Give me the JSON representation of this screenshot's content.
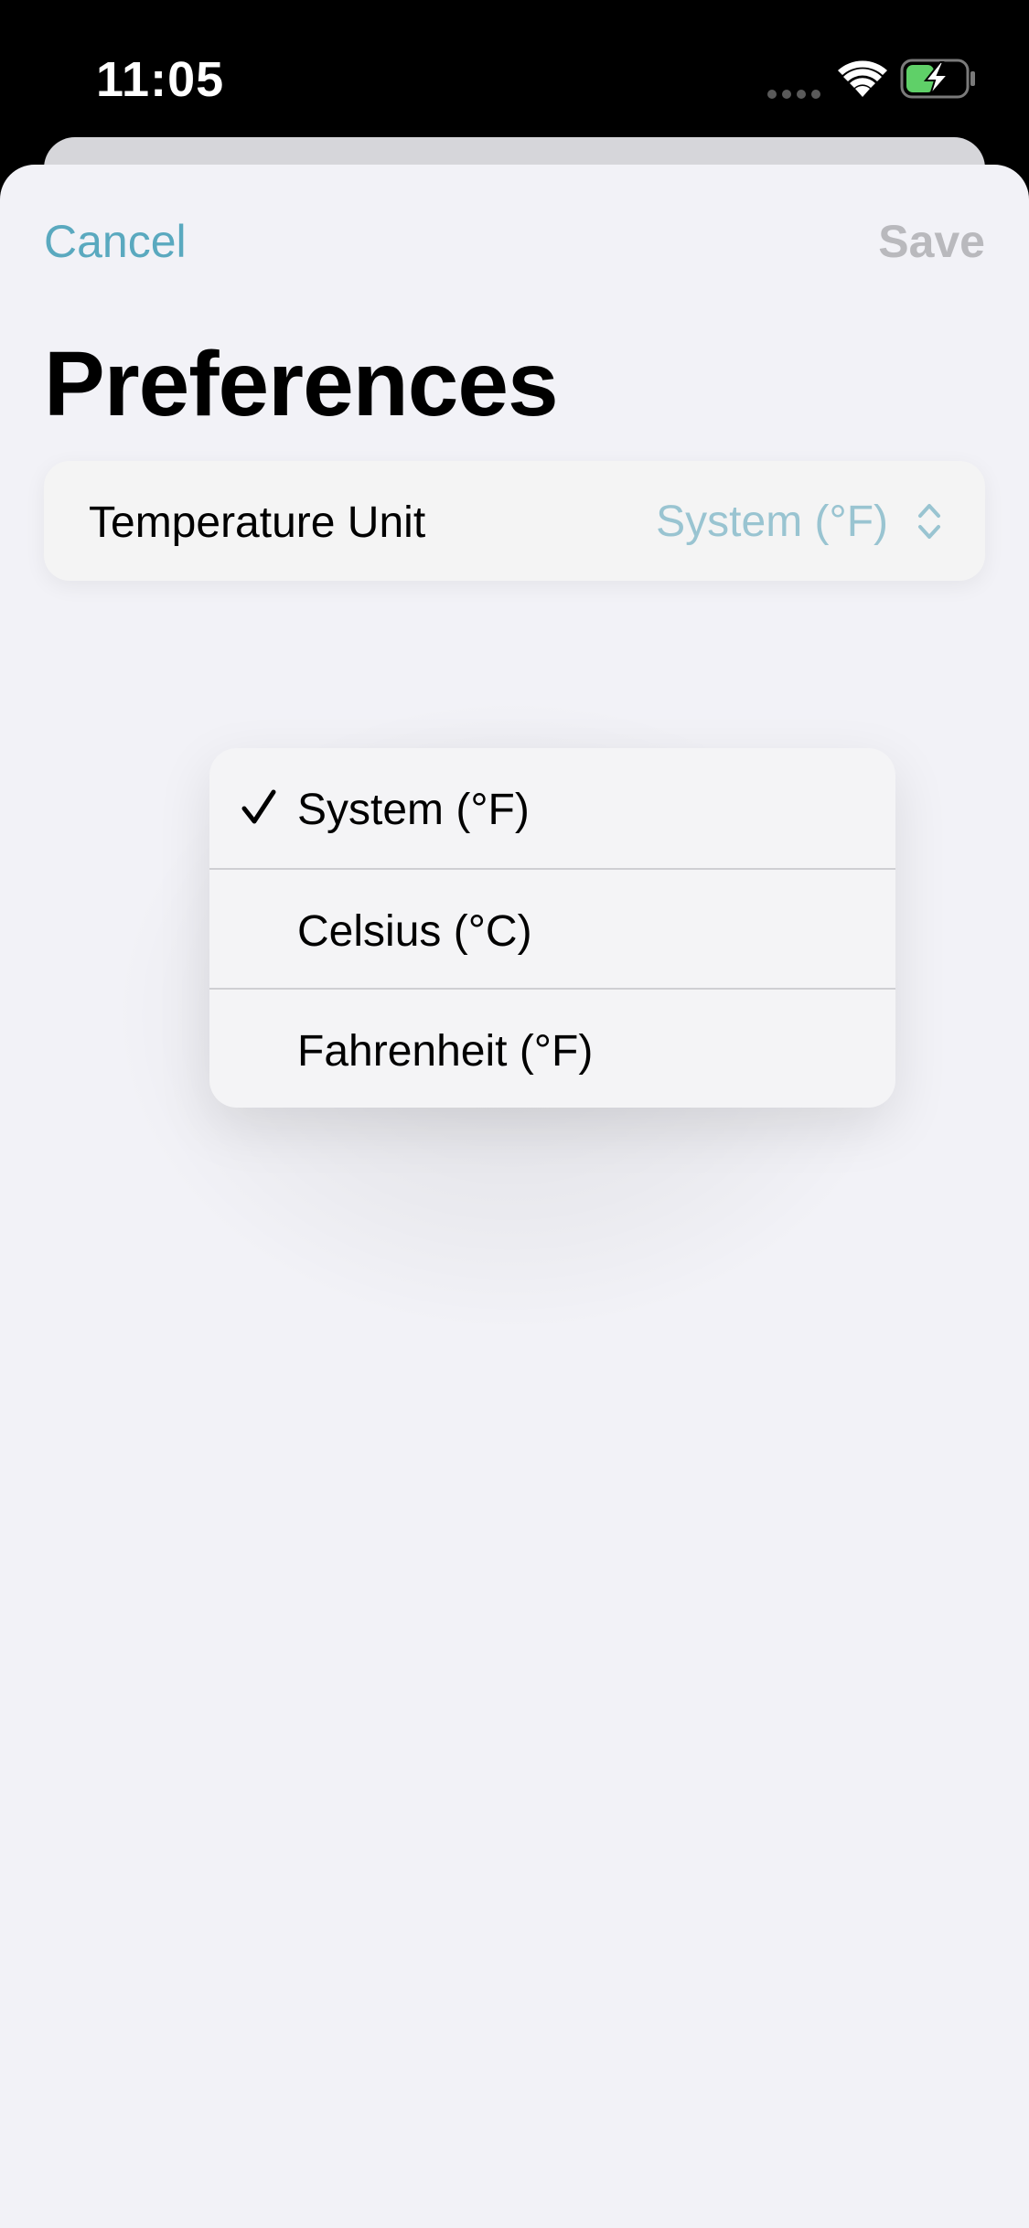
{
  "status_bar": {
    "time": "11:05"
  },
  "nav": {
    "cancel_label": "Cancel",
    "save_label": "Save"
  },
  "page": {
    "title": "Preferences"
  },
  "temperature_row": {
    "label": "Temperature Unit",
    "value": "System (°F)"
  },
  "menu": {
    "items": [
      {
        "label": "System (°F)",
        "selected": true
      },
      {
        "label": "Celsius (°C)",
        "selected": false
      },
      {
        "label": "Fahrenheit (°F)",
        "selected": false
      }
    ]
  },
  "colors": {
    "accent": "#5aa9bf",
    "disabled": "#b9b9bd",
    "value_tint": "#99c4d1",
    "background": "#f2f2f7"
  },
  "icons": {
    "signal": "signal-dots-icon",
    "wifi": "wifi-icon",
    "battery": "battery-charging-icon",
    "selector": "chevron-up-down-icon",
    "check": "checkmark-icon"
  }
}
